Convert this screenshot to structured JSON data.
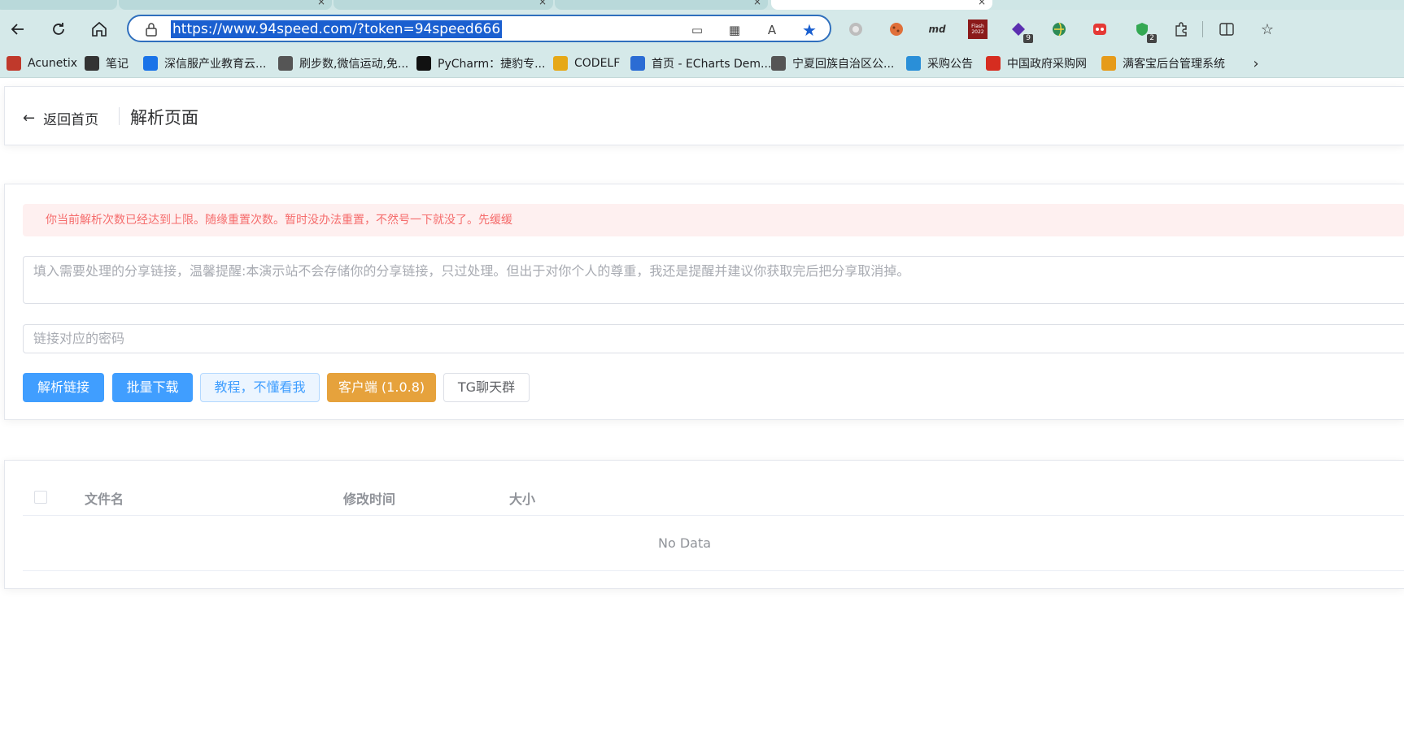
{
  "browser": {
    "url": "https://www.94speed.com/?token=94speed666",
    "extension_badges": {
      "purple": "9",
      "shield": "2"
    },
    "ext_md_label": "md",
    "ext_flash_label": "Flash 2022"
  },
  "bookmarks": [
    {
      "label": "Acunetix",
      "icon": "acunetix-icon",
      "color": "#c0392b"
    },
    {
      "label": "笔记",
      "icon": "note-edit-icon",
      "color": "#333333"
    },
    {
      "label": "深信服产业教育云...",
      "icon": "sangfor-icon",
      "color": "#1a73e8"
    },
    {
      "label": "刷步数,微信运动,免...",
      "icon": "page-icon",
      "color": "#555555"
    },
    {
      "label": "PyCharm：捷豹专...",
      "icon": "terminal-icon",
      "color": "#111111"
    },
    {
      "label": "CODELF",
      "icon": "codelf-icon",
      "color": "#e6a817"
    },
    {
      "label": "首页 - ECharts Dem...",
      "icon": "echarts-icon",
      "color": "#2b6cd4"
    },
    {
      "label": "宁夏回族自治区公...",
      "icon": "page-icon",
      "color": "#555555"
    },
    {
      "label": "采购公告",
      "icon": "ie-icon",
      "color": "#2a8fd8"
    },
    {
      "label": "中国政府采购网",
      "icon": "emblem-icon",
      "color": "#d62d20"
    },
    {
      "label": "满客宝后台管理系统",
      "icon": "manke-icon",
      "color": "#e69b1a"
    }
  ],
  "header": {
    "back_label": "返回首页",
    "title": "解析页面"
  },
  "alert": {
    "text": "你当前解析次数已经达到上限。随缘重置次数。暂时没办法重置，不然号一下就没了。先缓缓"
  },
  "form": {
    "link_placeholder": "填入需要处理的分享链接，温馨提醒:本演示站不会存储你的分享链接，只过处理。但出于对你个人的尊重，我还是提醒并建议你获取完后把分享取消掉。",
    "password_placeholder": "链接对应的密码"
  },
  "buttons": {
    "parse": "解析链接",
    "batch_download": "批量下载",
    "tutorial": "教程，不懂看我",
    "client": "客户端 (1.0.8)",
    "tg_group": "TG聊天群"
  },
  "table": {
    "columns": [
      "文件名",
      "修改时间",
      "大小"
    ],
    "empty_text": "No Data"
  },
  "colors": {
    "primary": "#409eff",
    "warning": "#e6a23c",
    "danger": "#f56c6c",
    "chrome": "#d5e9e9"
  }
}
